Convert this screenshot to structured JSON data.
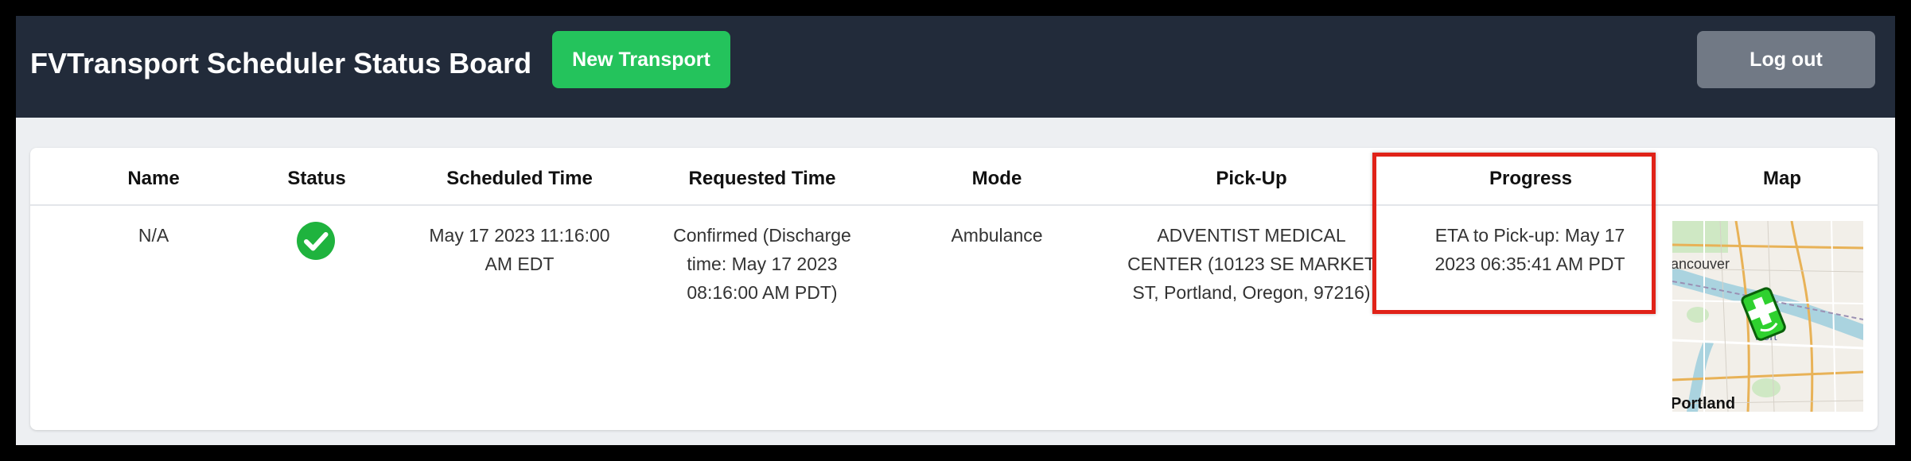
{
  "header": {
    "title": "FVTransport Scheduler Status Board",
    "new_transport_label": "New Transport",
    "logout_label": "Log out"
  },
  "table": {
    "columns": [
      "Name",
      "Status",
      "Scheduled Time",
      "Requested Time",
      "Mode",
      "Pick-Up",
      "Progress",
      "Map"
    ],
    "rows": [
      {
        "name": "N/A",
        "status_icon": "check-circle-icon",
        "status_color": "#1fb33e",
        "scheduled_time": "May 17 2023 11:16:00 AM EDT",
        "requested_time": "Confirmed (Discharge time: May 17 2023 08:16:00 AM PDT)",
        "mode": "Ambulance",
        "pickup": "ADVENTIST MEDICAL CENTER (10123 SE MARKET ST, Portland, Oregon, 97216)",
        "progress": "ETA to Pick-up: May 17 2023 06:35:41 AM PDT",
        "map": {
          "labels": [
            "ancouver",
            "Portland",
            "Port"
          ],
          "marker_icon": "ambulance-marker-icon"
        }
      }
    ]
  },
  "colors": {
    "topbar": "#222b3a",
    "new_button": "#24c35c",
    "logout_button": "#717985",
    "highlight": "#e02218"
  }
}
